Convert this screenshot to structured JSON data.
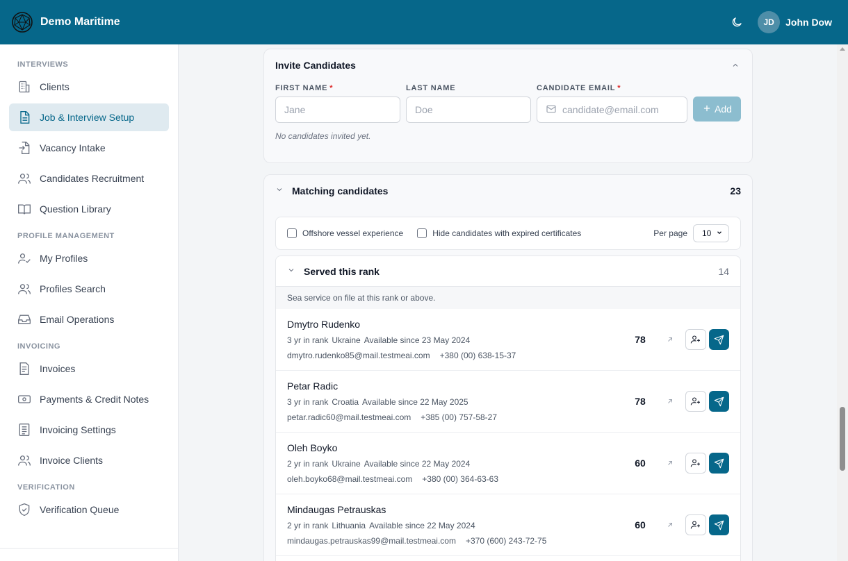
{
  "app": {
    "name": "Demo Maritime"
  },
  "user": {
    "initials": "JD",
    "name": "John Dow"
  },
  "sidebar": {
    "sections": {
      "interviews": "INTERVIEWS",
      "profile_management": "PROFILE MANAGEMENT",
      "invoicing": "INVOICING",
      "verification": "VERIFICATION"
    },
    "items": {
      "clients": "Clients",
      "job_setup": "Job & Interview Setup",
      "vacancy_intake": "Vacancy Intake",
      "candidates_recruitment": "Candidates Recruitment",
      "question_library": "Question Library",
      "my_profiles": "My Profiles",
      "profiles_search": "Profiles Search",
      "email_operations": "Email Operations",
      "invoices": "Invoices",
      "payments": "Payments & Credit Notes",
      "invoicing_settings": "Invoicing Settings",
      "invoice_clients": "Invoice Clients",
      "verification_queue": "Verification Queue"
    }
  },
  "invite": {
    "title": "Invite Candidates",
    "first_name_label": "FIRST NAME",
    "last_name_label": "LAST NAME",
    "email_label": "CANDIDATE EMAIL",
    "required_mark": "*",
    "first_name_placeholder": "Jane",
    "last_name_placeholder": "Doe",
    "email_placeholder": "candidate@email.com",
    "add_label": "Add",
    "empty_note": "No candidates invited yet."
  },
  "matching": {
    "title": "Matching candidates",
    "count": "23",
    "filters": {
      "offshore": "Offshore vessel experience",
      "hide_expired": "Hide candidates with expired certificates",
      "per_page_label": "Per page",
      "per_page_value": "10"
    },
    "rank_section": {
      "title": "Served this rank",
      "count": "14",
      "subtitle": "Sea service on file at this rank or above."
    },
    "candidates": [
      {
        "name": "Dmytro Rudenko",
        "rank_years": "3 yr in rank",
        "country": "Ukraine",
        "availability": "Available since 23 May 2024",
        "email": "dmytro.rudenko85@mail.testmeai.com",
        "phone": "+380 (00) 638-15-37",
        "score": "78"
      },
      {
        "name": "Petar Radic",
        "rank_years": "3 yr in rank",
        "country": "Croatia",
        "availability": "Available since 22 May 2025",
        "email": "petar.radic60@mail.testmeai.com",
        "phone": "+385 (00) 757-58-27",
        "score": "78"
      },
      {
        "name": "Oleh Boyko",
        "rank_years": "2 yr in rank",
        "country": "Ukraine",
        "availability": "Available since 22 May 2024",
        "email": "oleh.boyko68@mail.testmeai.com",
        "phone": "+380 (00) 364-63-63",
        "score": "60"
      },
      {
        "name": "Mindaugas Petrauskas",
        "rank_years": "2 yr in rank",
        "country": "Lithuania",
        "availability": "Available since 22 May 2024",
        "email": "mindaugas.petrauskas99@mail.testmeai.com",
        "phone": "+370 (600) 243-72-75",
        "score": "60"
      }
    ]
  },
  "colors": {
    "brand": "#06678a",
    "active_nav_bg": "#dfeaf0",
    "add_button_disabled": "#8cbdcf",
    "required": "#dc2626"
  },
  "icons": {
    "logo": "globe-network-icon",
    "theme": "moon-icon",
    "clients": "building-icon",
    "job_setup": "document-icon",
    "vacancy_intake": "file-import-icon",
    "candidates_recruitment": "users-icon",
    "question_library": "book-open-icon",
    "my_profiles": "user-check-icon",
    "profiles_search": "users-icon",
    "email_operations": "inbox-icon",
    "invoices": "file-text-icon",
    "payments": "banknote-icon",
    "invoicing_settings": "list-icon",
    "invoice_clients": "users-icon",
    "verification_queue": "shield-check-icon",
    "open_profile": "arrow-up-right-icon",
    "add_profile": "user-plus-icon",
    "send_invite": "send-icon"
  }
}
